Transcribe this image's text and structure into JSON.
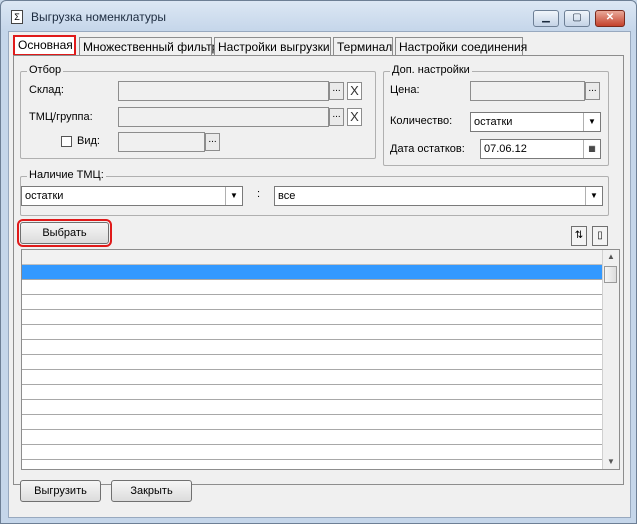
{
  "window": {
    "title": "Выгрузка номенклатуры",
    "app_icon": "document-icon"
  },
  "tabs": [
    {
      "label": "Основная"
    },
    {
      "label": "Множественный фильтр"
    },
    {
      "label": "Настройки выгрузки"
    },
    {
      "label": "Терминал"
    },
    {
      "label": "Настройки соединения"
    }
  ],
  "filter": {
    "group_label": "Отбор",
    "warehouse_label": "Склад:",
    "warehouse_value": "",
    "item_label": "ТМЦ/группа:",
    "item_value": "",
    "kind_label": "Вид:",
    "kind_value": "",
    "kind_checked": false
  },
  "extra": {
    "group_label": "Доп. настройки",
    "price_label": "Цена:",
    "price_value": "",
    "quantity_label": "Количество:",
    "quantity_value": "остатки",
    "date_label": "Дата остатков:",
    "date_value": "07.06.12"
  },
  "availability": {
    "group_label": "Наличие ТМЦ:",
    "left_value": "остатки",
    "separator": ":",
    "right_value": "все"
  },
  "buttons": {
    "select": "Выбрать",
    "export": "Выгрузить",
    "close": "Закрыть",
    "dots": "...",
    "clear": "X"
  },
  "grid": {
    "row_count": 13,
    "selected_row": 1
  },
  "colors": {
    "selection": "#3399ff",
    "highlight": "#e01a1a"
  }
}
